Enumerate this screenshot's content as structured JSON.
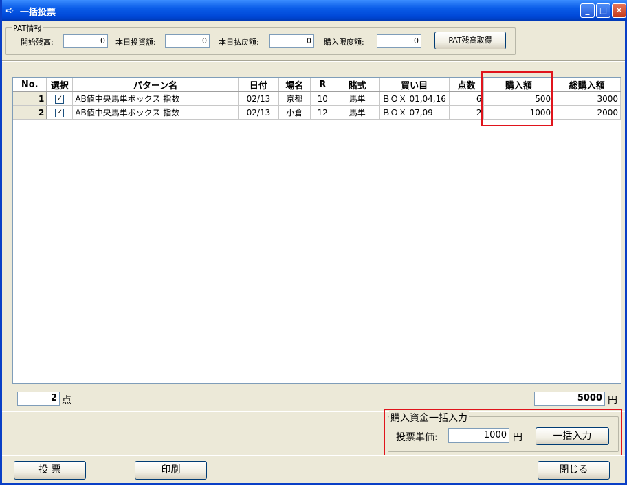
{
  "window": {
    "title": "一括投票"
  },
  "pat": {
    "group_label": "PAT情報",
    "start_balance_label": "開始残高:",
    "start_balance_value": "0",
    "today_bet_label": "本日投資額:",
    "today_bet_value": "0",
    "today_payout_label": "本日払戻額:",
    "today_payout_value": "0",
    "limit_label": "購入限度額:",
    "limit_value": "0",
    "fetch_button": "PAT残高取得"
  },
  "table": {
    "headers": [
      "No.",
      "選択",
      "パターン名",
      "日付",
      "場名",
      "R",
      "賭式",
      "買い目",
      "点数",
      "購入額",
      "総購入額"
    ],
    "rows": [
      {
        "no": "1",
        "checked": "✓",
        "pattern": "AB値中央馬単ボックス 指数",
        "date": "02/13",
        "venue": "京都",
        "race": "10",
        "bet_type": "馬単",
        "selection": "ＢＯＸ 01,04,16",
        "points": "6",
        "amount": "500",
        "total": "3000"
      },
      {
        "no": "2",
        "checked": "✓",
        "pattern": "AB値中央馬単ボックス 指数",
        "date": "02/13",
        "venue": "小倉",
        "race": "12",
        "bet_type": "馬単",
        "selection": "ＢＯＸ 07,09",
        "points": "2",
        "amount": "1000",
        "total": "2000"
      }
    ]
  },
  "summary": {
    "count_value": "2",
    "count_unit": "点",
    "total_value": "5000",
    "total_unit": "円"
  },
  "bulk": {
    "group_label": "購入資金一括入力",
    "unit_price_label": "投票単価:",
    "unit_price_value": "1000",
    "unit": "円",
    "apply_button": "一括入力"
  },
  "footer": {
    "vote_button": "投 票",
    "print_button": "印刷",
    "close_button": "閉じる"
  },
  "colors": {
    "highlight": "#e0141c",
    "titlebar": "#0a5ce8"
  }
}
